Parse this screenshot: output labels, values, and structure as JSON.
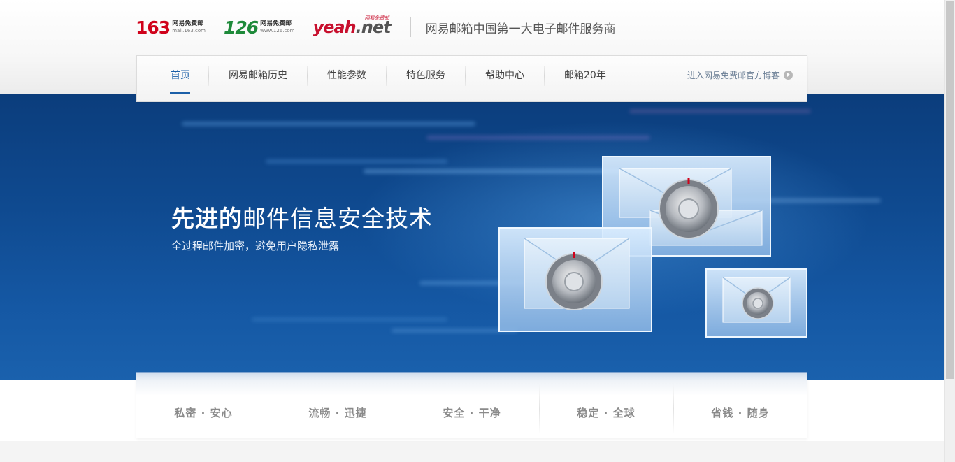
{
  "header": {
    "logos": [
      {
        "num": "163",
        "cn": "网易免费邮",
        "url": "mail.163.com"
      },
      {
        "num": "126",
        "cn": "网易免费邮",
        "url": "www.126.com"
      }
    ],
    "yeah_logo": {
      "main": "yeah",
      "ext": ".net",
      "tag": "网易免费邮"
    },
    "tagline": "网易邮箱中国第一大电子邮件服务商"
  },
  "nav": {
    "items": [
      "首页",
      "网易邮箱历史",
      "性能参数",
      "特色服务",
      "帮助中心",
      "邮箱20年"
    ],
    "active_index": 0,
    "blog_link": "进入网易免费邮官方博客"
  },
  "hero": {
    "title_strong": "先进的",
    "title_rest": "邮件信息安全技术",
    "subtitle": "全过程邮件加密，避免用户隐私泄露"
  },
  "features": [
    "私密 · 安心",
    "流畅 · 迅捷",
    "安全 · 干净",
    "稳定 · 全球",
    "省钱 · 随身"
  ],
  "colors": {
    "brand_red": "#d0021b",
    "brand_green": "#1e8a3a",
    "nav_active": "#1b5fa8",
    "hero_blue": "#0f4a90"
  }
}
